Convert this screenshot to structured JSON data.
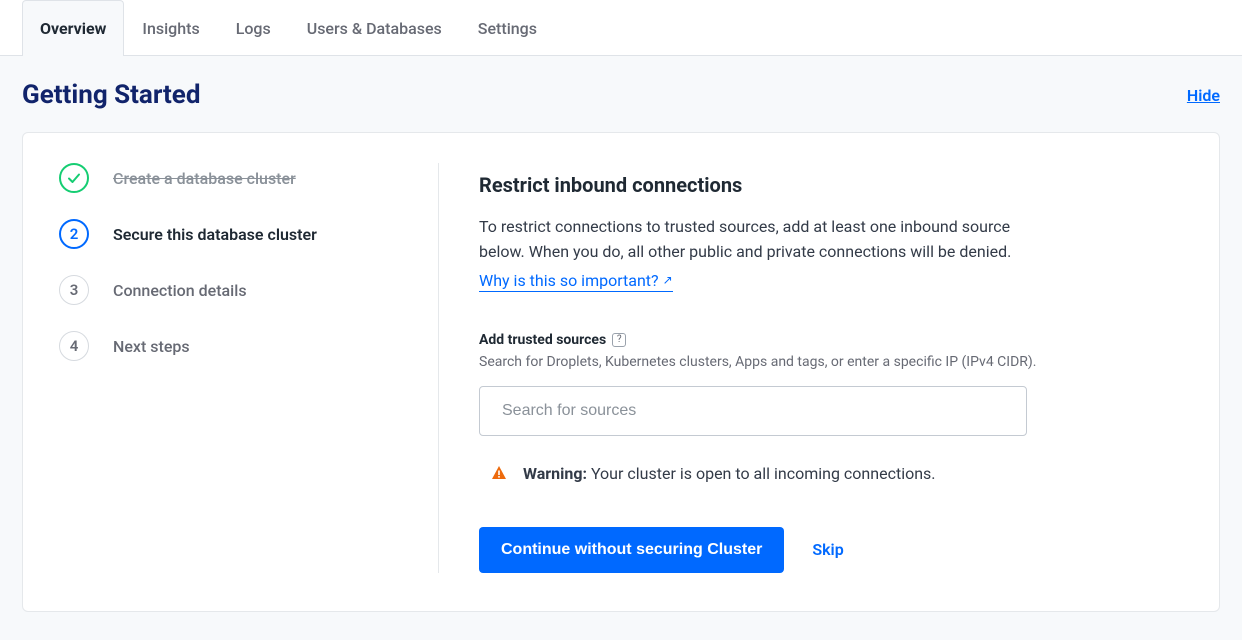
{
  "tabs": [
    {
      "label": "Overview",
      "active": true
    },
    {
      "label": "Insights",
      "active": false
    },
    {
      "label": "Logs",
      "active": false
    },
    {
      "label": "Users & Databases",
      "active": false
    },
    {
      "label": "Settings",
      "active": false
    }
  ],
  "header": {
    "title": "Getting Started",
    "hide": "Hide"
  },
  "steps": [
    {
      "num": "1",
      "label": "Create a database cluster",
      "state": "done"
    },
    {
      "num": "2",
      "label": "Secure this database cluster",
      "state": "active"
    },
    {
      "num": "3",
      "label": "Connection details",
      "state": "pending"
    },
    {
      "num": "4",
      "label": "Next steps",
      "state": "pending"
    }
  ],
  "content": {
    "title": "Restrict inbound connections",
    "body": "To restrict connections to trusted sources, add at least one inbound source below. When you do, all other public and private connections will be denied.",
    "link": "Why is this so important?",
    "form": {
      "label": "Add trusted sources",
      "help": "Search for Droplets, Kubernetes clusters, Apps and tags, or enter a specific IP (IPv4 CIDR).",
      "placeholder": "Search for sources"
    },
    "warning": {
      "label": "Warning:",
      "text": " Your cluster is open to all incoming connections."
    },
    "buttons": {
      "primary": "Continue without securing Cluster",
      "skip": "Skip"
    }
  }
}
